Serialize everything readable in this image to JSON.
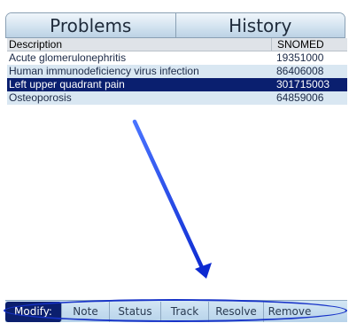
{
  "tabs": {
    "problems": "Problems",
    "history": "History"
  },
  "table": {
    "columns": [
      "Description",
      "SNOMED"
    ],
    "rows": [
      {
        "description": "Acute glomerulonephritis",
        "snomed": "19351000"
      },
      {
        "description": "Human immunodeficiency virus infection",
        "snomed": "86406008"
      },
      {
        "description": "Left upper quadrant pain",
        "snomed": "301715003"
      },
      {
        "description": "Osteoporosis",
        "snomed": "64859006"
      }
    ],
    "selected_row": "Left upper quadrant pain"
  },
  "toolbar": {
    "buttons": [
      "Modify:",
      "Note",
      "Status",
      "Track",
      "Resolve",
      "Remove"
    ],
    "active": "Modify:"
  },
  "annotation": {
    "color": "#1733c8"
  },
  "colors": {
    "selected_row_bg": "#0a1f6f",
    "alt_row_bg": "#d9e7f2",
    "toolbar_bg": "#c4dcef"
  }
}
